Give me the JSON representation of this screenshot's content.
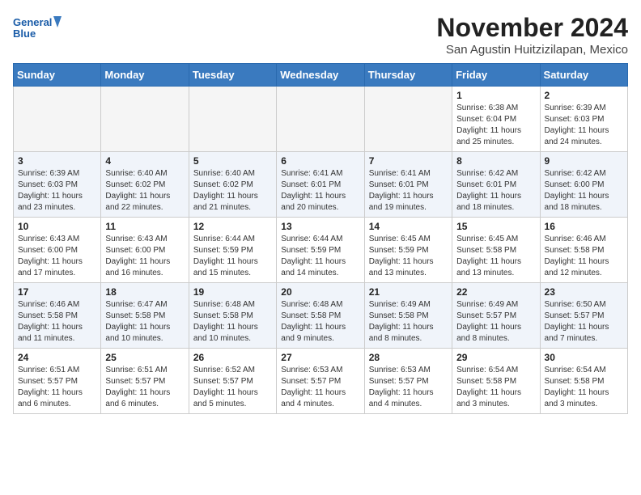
{
  "header": {
    "logo_line1": "General",
    "logo_line2": "Blue",
    "month": "November 2024",
    "location": "San Agustin Huitzizilapan, Mexico"
  },
  "weekdays": [
    "Sunday",
    "Monday",
    "Tuesday",
    "Wednesday",
    "Thursday",
    "Friday",
    "Saturday"
  ],
  "weeks": [
    [
      {
        "day": "",
        "info": ""
      },
      {
        "day": "",
        "info": ""
      },
      {
        "day": "",
        "info": ""
      },
      {
        "day": "",
        "info": ""
      },
      {
        "day": "",
        "info": ""
      },
      {
        "day": "1",
        "info": "Sunrise: 6:38 AM\nSunset: 6:04 PM\nDaylight: 11 hours and 25 minutes."
      },
      {
        "day": "2",
        "info": "Sunrise: 6:39 AM\nSunset: 6:03 PM\nDaylight: 11 hours and 24 minutes."
      }
    ],
    [
      {
        "day": "3",
        "info": "Sunrise: 6:39 AM\nSunset: 6:03 PM\nDaylight: 11 hours and 23 minutes."
      },
      {
        "day": "4",
        "info": "Sunrise: 6:40 AM\nSunset: 6:02 PM\nDaylight: 11 hours and 22 minutes."
      },
      {
        "day": "5",
        "info": "Sunrise: 6:40 AM\nSunset: 6:02 PM\nDaylight: 11 hours and 21 minutes."
      },
      {
        "day": "6",
        "info": "Sunrise: 6:41 AM\nSunset: 6:01 PM\nDaylight: 11 hours and 20 minutes."
      },
      {
        "day": "7",
        "info": "Sunrise: 6:41 AM\nSunset: 6:01 PM\nDaylight: 11 hours and 19 minutes."
      },
      {
        "day": "8",
        "info": "Sunrise: 6:42 AM\nSunset: 6:01 PM\nDaylight: 11 hours and 18 minutes."
      },
      {
        "day": "9",
        "info": "Sunrise: 6:42 AM\nSunset: 6:00 PM\nDaylight: 11 hours and 18 minutes."
      }
    ],
    [
      {
        "day": "10",
        "info": "Sunrise: 6:43 AM\nSunset: 6:00 PM\nDaylight: 11 hours and 17 minutes."
      },
      {
        "day": "11",
        "info": "Sunrise: 6:43 AM\nSunset: 6:00 PM\nDaylight: 11 hours and 16 minutes."
      },
      {
        "day": "12",
        "info": "Sunrise: 6:44 AM\nSunset: 5:59 PM\nDaylight: 11 hours and 15 minutes."
      },
      {
        "day": "13",
        "info": "Sunrise: 6:44 AM\nSunset: 5:59 PM\nDaylight: 11 hours and 14 minutes."
      },
      {
        "day": "14",
        "info": "Sunrise: 6:45 AM\nSunset: 5:59 PM\nDaylight: 11 hours and 13 minutes."
      },
      {
        "day": "15",
        "info": "Sunrise: 6:45 AM\nSunset: 5:58 PM\nDaylight: 11 hours and 13 minutes."
      },
      {
        "day": "16",
        "info": "Sunrise: 6:46 AM\nSunset: 5:58 PM\nDaylight: 11 hours and 12 minutes."
      }
    ],
    [
      {
        "day": "17",
        "info": "Sunrise: 6:46 AM\nSunset: 5:58 PM\nDaylight: 11 hours and 11 minutes."
      },
      {
        "day": "18",
        "info": "Sunrise: 6:47 AM\nSunset: 5:58 PM\nDaylight: 11 hours and 10 minutes."
      },
      {
        "day": "19",
        "info": "Sunrise: 6:48 AM\nSunset: 5:58 PM\nDaylight: 11 hours and 10 minutes."
      },
      {
        "day": "20",
        "info": "Sunrise: 6:48 AM\nSunset: 5:58 PM\nDaylight: 11 hours and 9 minutes."
      },
      {
        "day": "21",
        "info": "Sunrise: 6:49 AM\nSunset: 5:58 PM\nDaylight: 11 hours and 8 minutes."
      },
      {
        "day": "22",
        "info": "Sunrise: 6:49 AM\nSunset: 5:57 PM\nDaylight: 11 hours and 8 minutes."
      },
      {
        "day": "23",
        "info": "Sunrise: 6:50 AM\nSunset: 5:57 PM\nDaylight: 11 hours and 7 minutes."
      }
    ],
    [
      {
        "day": "24",
        "info": "Sunrise: 6:51 AM\nSunset: 5:57 PM\nDaylight: 11 hours and 6 minutes."
      },
      {
        "day": "25",
        "info": "Sunrise: 6:51 AM\nSunset: 5:57 PM\nDaylight: 11 hours and 6 minutes."
      },
      {
        "day": "26",
        "info": "Sunrise: 6:52 AM\nSunset: 5:57 PM\nDaylight: 11 hours and 5 minutes."
      },
      {
        "day": "27",
        "info": "Sunrise: 6:53 AM\nSunset: 5:57 PM\nDaylight: 11 hours and 4 minutes."
      },
      {
        "day": "28",
        "info": "Sunrise: 6:53 AM\nSunset: 5:57 PM\nDaylight: 11 hours and 4 minutes."
      },
      {
        "day": "29",
        "info": "Sunrise: 6:54 AM\nSunset: 5:58 PM\nDaylight: 11 hours and 3 minutes."
      },
      {
        "day": "30",
        "info": "Sunrise: 6:54 AM\nSunset: 5:58 PM\nDaylight: 11 hours and 3 minutes."
      }
    ]
  ]
}
